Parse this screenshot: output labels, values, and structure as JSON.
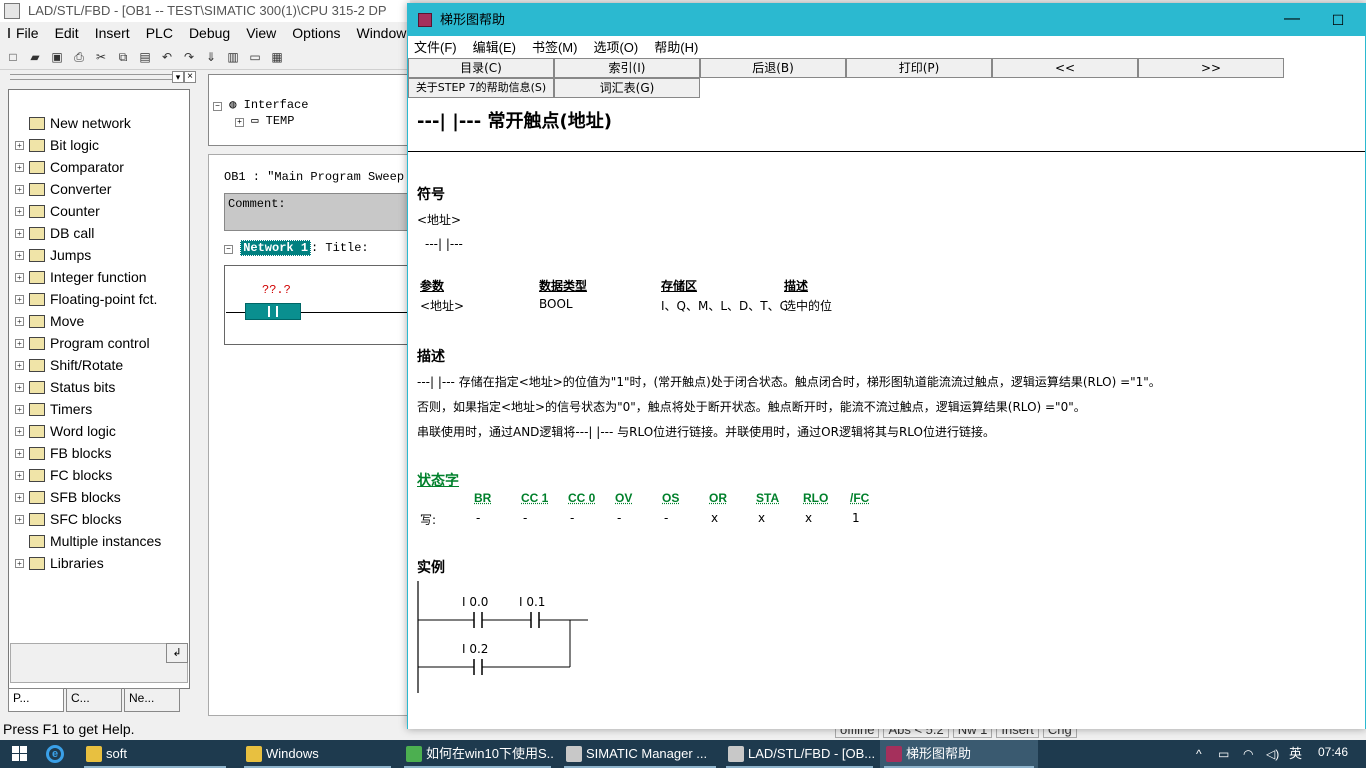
{
  "bg_window": {
    "title": "LAD/STL/FBD  - [OB1 -- TEST\\SIMATIC 300(1)\\CPU 315-2 DP",
    "menu": [
      "File",
      "Edit",
      "Insert",
      "PLC",
      "Debug",
      "View",
      "Options",
      "Window"
    ],
    "tree": [
      {
        "label": "New network",
        "expand": false,
        "icon": "NEW"
      },
      {
        "label": "Bit logic",
        "expand": true,
        "icon": "-||-"
      },
      {
        "label": "Comparator",
        "expand": true,
        "icon": "CMP"
      },
      {
        "label": "Converter",
        "expand": true,
        "icon": "CV"
      },
      {
        "label": "Counter",
        "expand": true,
        "icon": "+1"
      },
      {
        "label": "DB call",
        "expand": true,
        "icon": "DB"
      },
      {
        "label": "Jumps",
        "expand": true,
        "icon": "JMP"
      },
      {
        "label": "Integer function",
        "expand": true,
        "icon": "±"
      },
      {
        "label": "Floating-point fct.",
        "expand": true,
        "icon": "±R"
      },
      {
        "label": "Move",
        "expand": true,
        "icon": "MV"
      },
      {
        "label": "Program control",
        "expand": true,
        "icon": "RET"
      },
      {
        "label": "Shift/Rotate",
        "expand": true,
        "icon": "SH"
      },
      {
        "label": "Status bits",
        "expand": true,
        "icon": "ST"
      },
      {
        "label": "Timers",
        "expand": true,
        "icon": "T"
      },
      {
        "label": "Word logic",
        "expand": true,
        "icon": "W"
      },
      {
        "label": "FB blocks",
        "expand": true,
        "icon": "FB"
      },
      {
        "label": "FC blocks",
        "expand": true,
        "icon": "FC"
      },
      {
        "label": "SFB blocks",
        "expand": true,
        "icon": "SFB"
      },
      {
        "label": "SFC blocks",
        "expand": true,
        "icon": "SFC"
      },
      {
        "label": "Multiple instances",
        "expand": false,
        "icon": "MI"
      },
      {
        "label": "Libraries",
        "expand": true,
        "icon": "LIB"
      }
    ],
    "tabs": [
      "P...",
      "C...",
      "Ne..."
    ],
    "interface": {
      "root": "Interface",
      "child": "TEMP"
    },
    "ob_title": "OB1 :  \"Main Program Sweep",
    "comment_label": "Comment:",
    "network_label": "Network 1",
    "network_title": ": Title:",
    "contact_addr": "??.?",
    "status_text": "Press F1 to get Help.",
    "status_cells": [
      "offline",
      "Abs < 5.2",
      "Nw 1",
      "Insert",
      "Chg"
    ]
  },
  "help": {
    "title": "梯形图帮助",
    "menu": [
      "文件(F)",
      "编辑(E)",
      "书签(M)",
      "选项(O)",
      "帮助(H)"
    ],
    "buttons_row1": [
      "目录(C)",
      "索引(I)",
      "后退(B)",
      "打印(P)",
      "<<",
      ">>"
    ],
    "buttons_row2": [
      "关于STEP 7的帮助信息(S)",
      "词汇表(G)"
    ],
    "heading": "---|  |---  常开触点(地址)",
    "symbol_title": "符号",
    "symbol_addr": "<地址>",
    "symbol_glyph": "---|  |---",
    "param_table": {
      "headers": [
        "参数",
        "数据类型",
        "存储区",
        "描述"
      ],
      "row": [
        "<地址>",
        "BOOL",
        "I、Q、M、L、D、T、C",
        "选中的位"
      ]
    },
    "desc_title": "描述",
    "desc_lines": [
      "---|  |--- 存储在指定<地址>的位值为\"1\"时，(常开触点)处于闭合状态。触点闭合时，梯形图轨道能流流过触点，逻辑运算结果(RLO) =\"1\"。",
      "否则，如果指定<地址>的信号状态为\"0\"，触点将处于断开状态。触点断开时，能流不流过触点，逻辑运算结果(RLO) =\"0\"。",
      "串联使用时，通过AND逻辑将---|  |--- 与RLO位进行链接。并联使用时，通过OR逻辑将其与RLO位进行链接。"
    ],
    "status_title": "状态字",
    "status_headers": [
      "BR",
      "CC 1",
      "CC 0",
      "OV",
      "OS",
      "OR",
      "STA",
      "RLO",
      "/FC"
    ],
    "status_write_label": "写:",
    "status_values": [
      "-",
      "-",
      "-",
      "-",
      "-",
      "x",
      "x",
      "x",
      "1"
    ],
    "example_title": "实例",
    "example_contacts": [
      "I 0.0",
      "I 0.1",
      "I 0.2"
    ]
  },
  "taskbar": {
    "items": [
      {
        "label": "soft",
        "color": "#e8c040"
      },
      {
        "label": "Windows",
        "color": "#e8c040"
      },
      {
        "label": "如何在win10下使用S...",
        "color": "#4caf50"
      },
      {
        "label": "SIMATIC Manager ...",
        "color": "#c8c8c8"
      },
      {
        "label": "LAD/STL/FBD  - [OB...",
        "color": "#c8c8c8"
      },
      {
        "label": "梯形图帮助",
        "color": "#a5305c"
      }
    ],
    "ime": "英",
    "clock": "07:46"
  }
}
